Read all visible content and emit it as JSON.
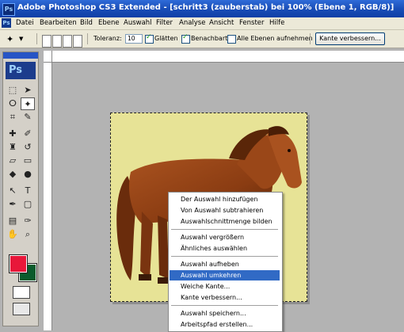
{
  "window": {
    "title": "Adobe Photoshop CS3 Extended - [schritt3 (zauberstab) bei 100% (Ebene 1, RGB/8)]",
    "app_icon": "Ps"
  },
  "menubar": {
    "items": [
      "Datei",
      "Bearbeiten",
      "Bild",
      "Ebene",
      "Auswahl",
      "Filter",
      "Analyse",
      "Ansicht",
      "Fenster",
      "Hilfe"
    ]
  },
  "options": {
    "tolerance_label": "Toleranz:",
    "tolerance_value": "10",
    "smooth_label": "Glätten",
    "smooth_checked": true,
    "contiguous_label": "Benachbart",
    "contiguous_checked": true,
    "all_layers_label": "Alle Ebenen aufnehmen",
    "all_layers_checked": false,
    "refine_button": "Kante verbessern..."
  },
  "toolbox": {
    "logo": "Ps",
    "foreground_color": "#e8173a",
    "background_color": "#0a5b2c"
  },
  "document": {
    "canvas_color": "#e7e396",
    "subject": "horse-image"
  },
  "context_menu": {
    "items": [
      {
        "label": "Der Auswahl hinzufügen"
      },
      {
        "label": "Von Auswahl subtrahieren"
      },
      {
        "label": "Auswahlschnittmenge bilden"
      },
      {
        "label": "Auswahl vergrößern"
      },
      {
        "label": "Ähnliches auswählen"
      },
      {
        "label": "Auswahl aufheben"
      },
      {
        "label": "Auswahl umkehren",
        "highlighted": true
      },
      {
        "label": "Weiche Kante..."
      },
      {
        "label": "Kante verbessern..."
      },
      {
        "label": "Auswahl speichern..."
      },
      {
        "label": "Arbeitspfad erstellen..."
      }
    ]
  },
  "colors": {
    "title_bar": "#1a4eb8",
    "menu_highlight": "#316ac5",
    "chrome": "#ece9d8"
  }
}
